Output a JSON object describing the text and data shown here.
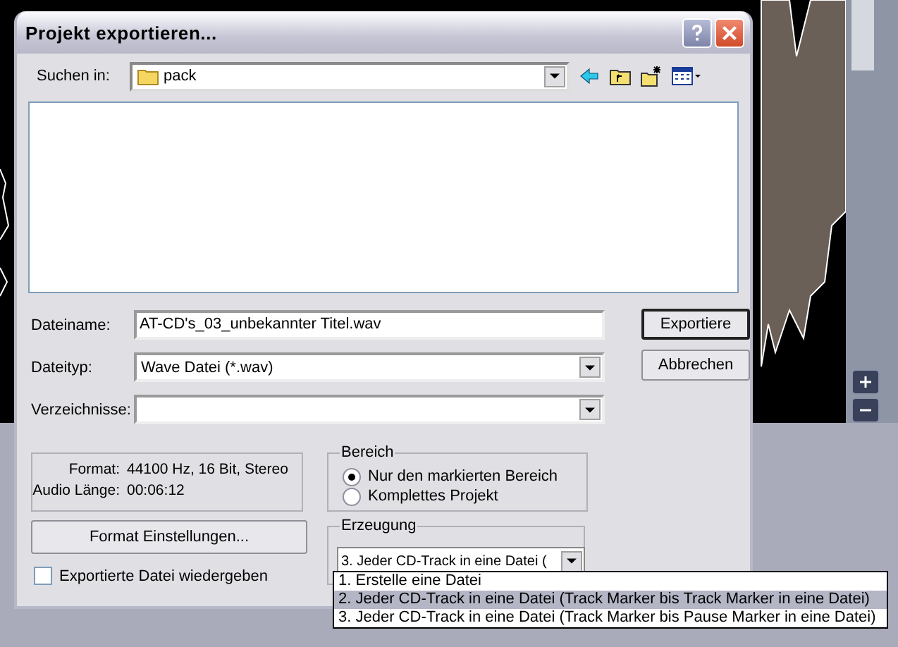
{
  "window": {
    "title": "Projekt exportieren..."
  },
  "look_in": {
    "label": "Suchen in:",
    "value": "pack"
  },
  "fields": [
    {
      "kind": "text",
      "label": "Dateiname:",
      "value": "AT-CD's_03_unbekannter Titel.wav"
    },
    {
      "kind": "combo",
      "label": "Dateityp:",
      "value": "Wave Datei (*.wav)"
    },
    {
      "kind": "combo",
      "label": "Verzeichnisse:"
    }
  ],
  "actions": [
    {
      "label": "Exportiere",
      "default": true
    },
    {
      "label": "Abbrechen",
      "default": false
    }
  ],
  "info": [
    {
      "label": "Format:",
      "value": "44100 Hz, 16 Bit, Stereo"
    },
    {
      "label": "Audio Länge:",
      "value": "00:06:12"
    }
  ],
  "format_button": "Format Einstellungen...",
  "play_checkbox": {
    "label": "Exportierte Datei wiedergeben",
    "checked": false
  },
  "range": {
    "title": "Bereich",
    "options": [
      {
        "label": "Nur den markierten Bereich",
        "selected": true
      },
      {
        "label": "Komplettes Projekt",
        "selected": false
      }
    ]
  },
  "generation": {
    "title": "Erzeugung",
    "value": "3. Jeder CD-Track in eine Datei (",
    "options": [
      {
        "label": "1. Erstelle eine Datei",
        "selected": false
      },
      {
        "label": "2. Jeder CD-Track in eine Datei (Track Marker bis Track Marker in eine Datei)",
        "selected": true
      },
      {
        "label": "3. Jeder CD-Track in eine Datei (Track Marker bis Pause Marker in eine Datei)",
        "selected": false
      }
    ]
  }
}
